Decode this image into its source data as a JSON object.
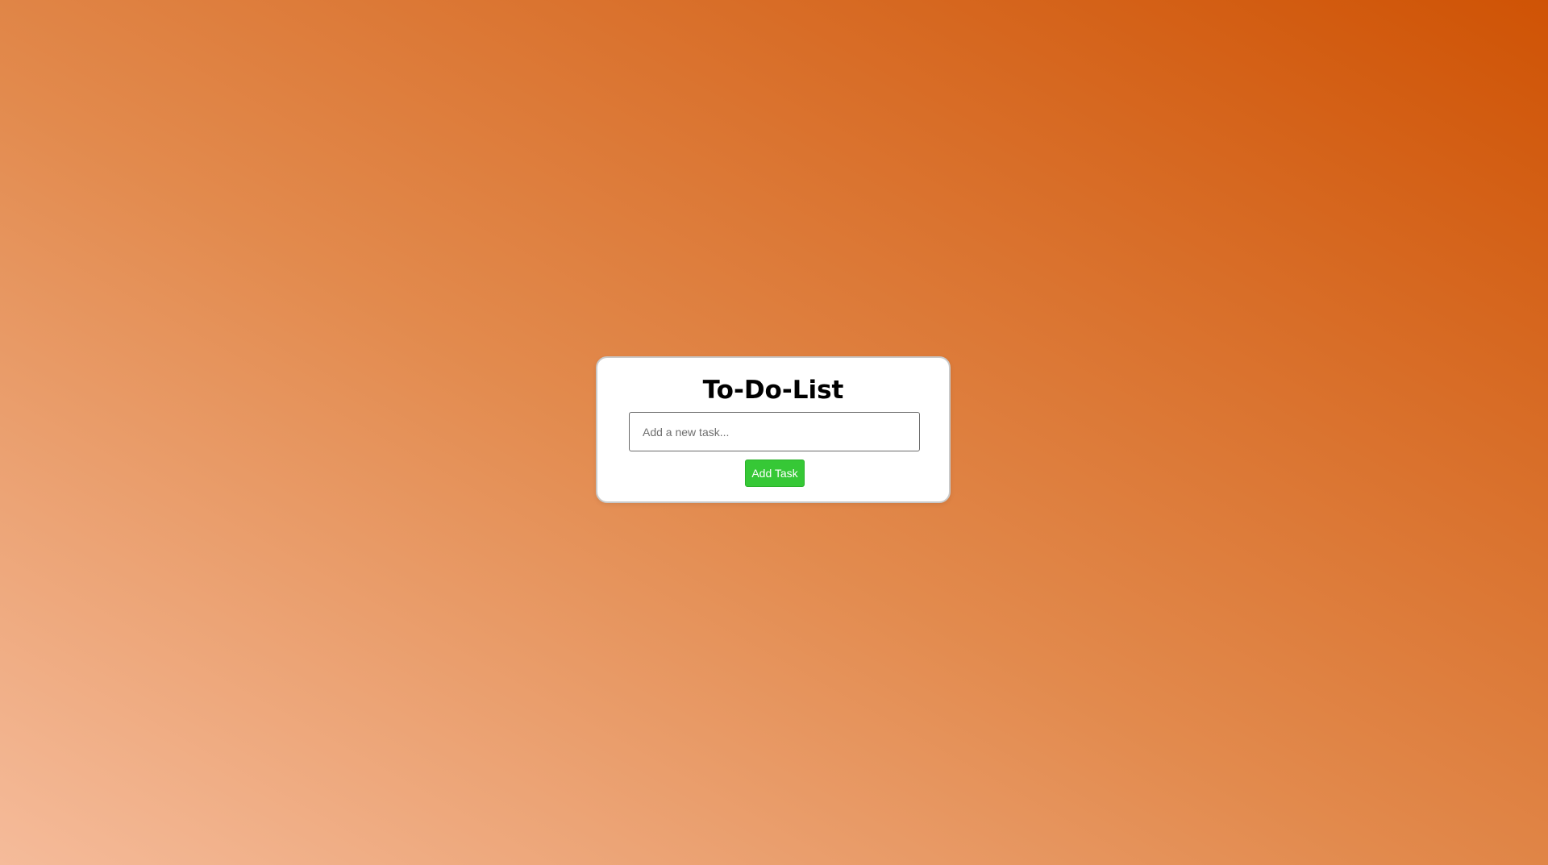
{
  "app": {
    "title": "To-Do-List"
  },
  "task_input": {
    "value": "",
    "placeholder": "Add a new task..."
  },
  "add_button": {
    "label": "Add Task"
  },
  "colors": {
    "background_gradient_light": "#f5bb9a",
    "background_gradient_dark": "#cf5305",
    "card_background": "#ffffff",
    "button_green": "#36c836",
    "title_text": "#000000"
  },
  "tasks": []
}
